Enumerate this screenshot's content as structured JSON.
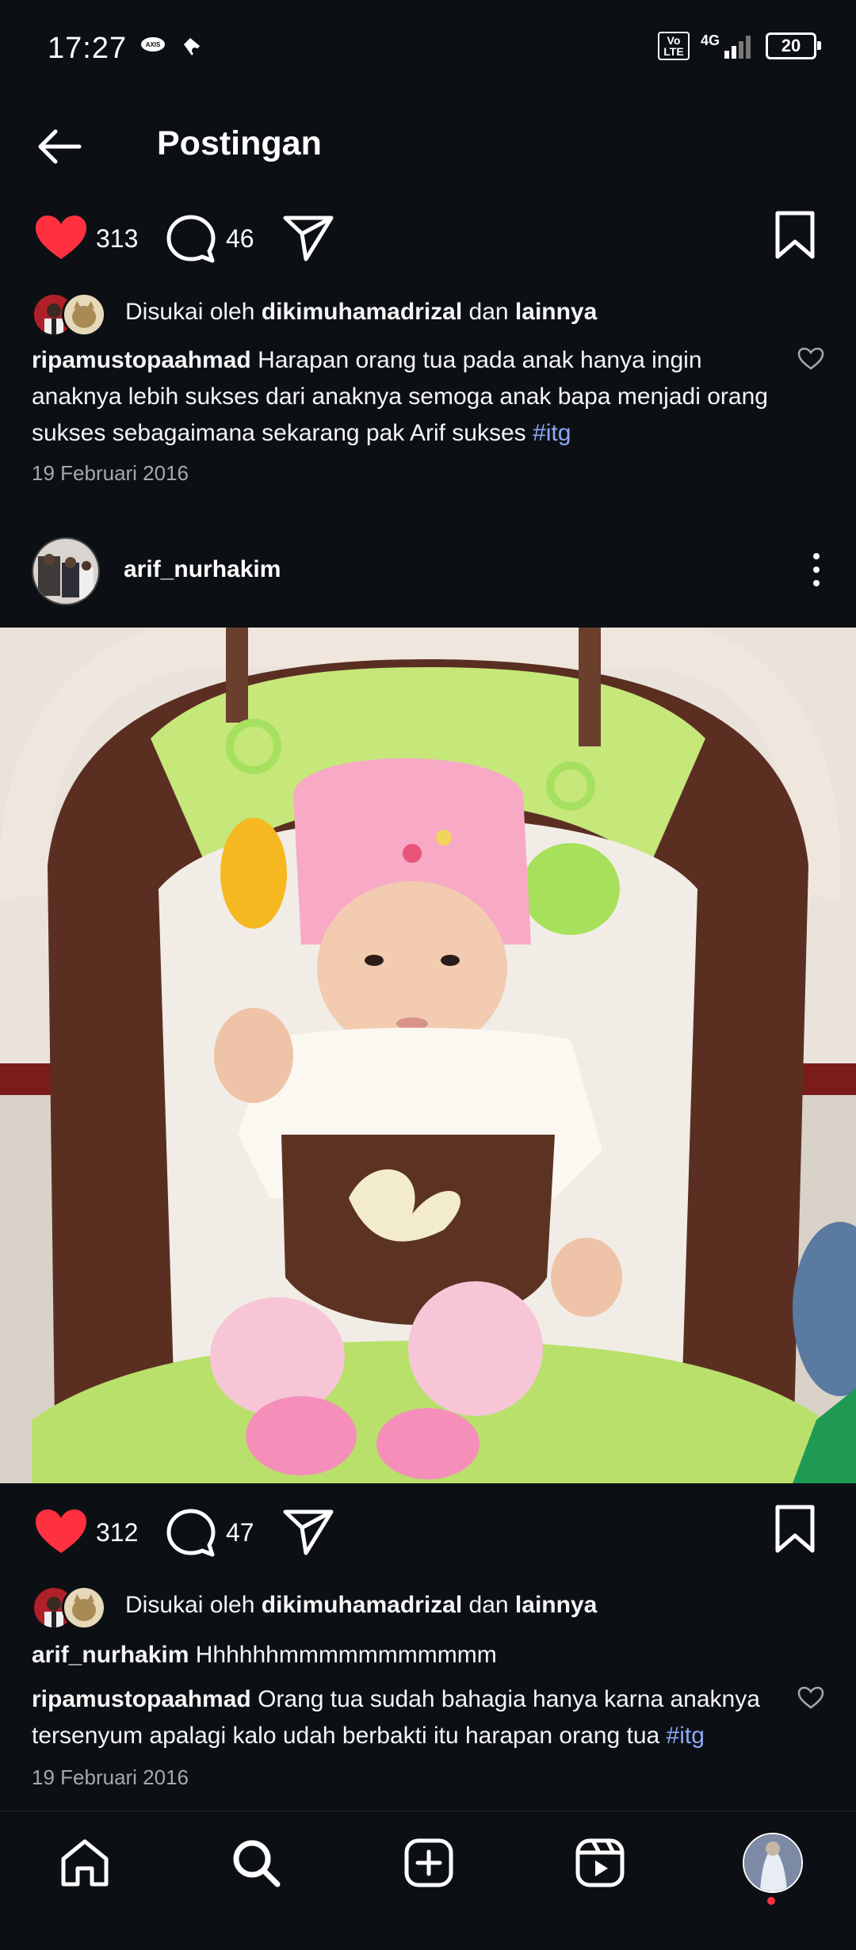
{
  "status_bar": {
    "time": "17:27",
    "volte": "Vo LTE",
    "network": "4G",
    "battery": "20"
  },
  "header": {
    "title": "Postingan"
  },
  "post1": {
    "likes": "313",
    "comments": "46",
    "liked_by_prefix": "Disukai oleh",
    "liked_by_user": "dikimuhamadrizal",
    "liked_by_and": "dan",
    "liked_by_others": "lainnya",
    "caption_user": "ripamustopaahmad",
    "caption_text": "Harapan orang tua pada anak hanya ingin anaknya lebih sukses dari anaknya semoga anak bapa menjadi orang sukses sebagaimana sekarang pak Arif sukses",
    "caption_tag": "#itg",
    "date": "19 Februari 2016"
  },
  "post2": {
    "username": "arif_nurhakim",
    "likes": "312",
    "comments": "47",
    "liked_by_prefix": "Disukai oleh",
    "liked_by_user": "dikimuhamadrizal",
    "liked_by_and": "dan",
    "liked_by_others": "lainnya",
    "caption_user": "arif_nurhakim",
    "caption_text": "Hhhhhhmmmmmmmmmmm",
    "comment_user": "ripamustopaahmad",
    "comment_text": "Orang tua sudah bahagia hanya karna anaknya tersenyum apalagi kalo udah berbakti itu harapan orang tua",
    "comment_tag": "#itg",
    "date": "19 Februari 2016"
  },
  "icons": {
    "back": "arrow-left-icon",
    "like": "heart-icon",
    "comment": "comment-icon",
    "share": "send-icon",
    "save": "bookmark-icon",
    "more": "more-vertical-icon",
    "home": "home-icon",
    "search": "search-icon",
    "create": "plus-square-icon",
    "reels": "reels-icon"
  },
  "colors": {
    "background": "#0c1014",
    "like_red": "#ff3040",
    "hashtag": "#8da7f5",
    "muted": "#a8a8a8"
  }
}
